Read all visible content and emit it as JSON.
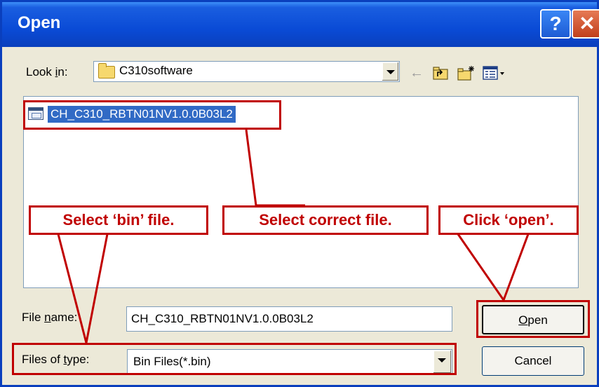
{
  "window": {
    "title": "Open",
    "help_glyph": "?",
    "close_glyph": "✕"
  },
  "look_in": {
    "label_prefix": "Look ",
    "label_accel": "i",
    "label_suffix": "n:",
    "value": "C310software"
  },
  "toolbar": {
    "back_icon": "back-arrow-icon",
    "up_icon": "up-folder-icon",
    "new_folder_icon": "new-folder-icon",
    "view_menu_icon": "view-menu-icon"
  },
  "file_list": {
    "items": [
      {
        "name": "CH_C310_RBTN01NV1.0.0B03L2",
        "selected": true
      }
    ]
  },
  "file_name": {
    "label_prefix": "File ",
    "label_accel": "n",
    "label_suffix": "ame:",
    "value": "CH_C310_RBTN01NV1.0.0B03L2"
  },
  "files_of_type": {
    "label_prefix": "Files of ",
    "label_accel": "t",
    "label_suffix": "ype:",
    "value": "Bin Files(*.bin)"
  },
  "buttons": {
    "open_accel": "O",
    "open_rest": "pen",
    "cancel": "Cancel"
  },
  "annotations": {
    "select_bin": "Select ‘bin’ file.",
    "select_file": "Select correct file.",
    "click_open": "Click ‘open’.",
    "color": "#c00000"
  }
}
